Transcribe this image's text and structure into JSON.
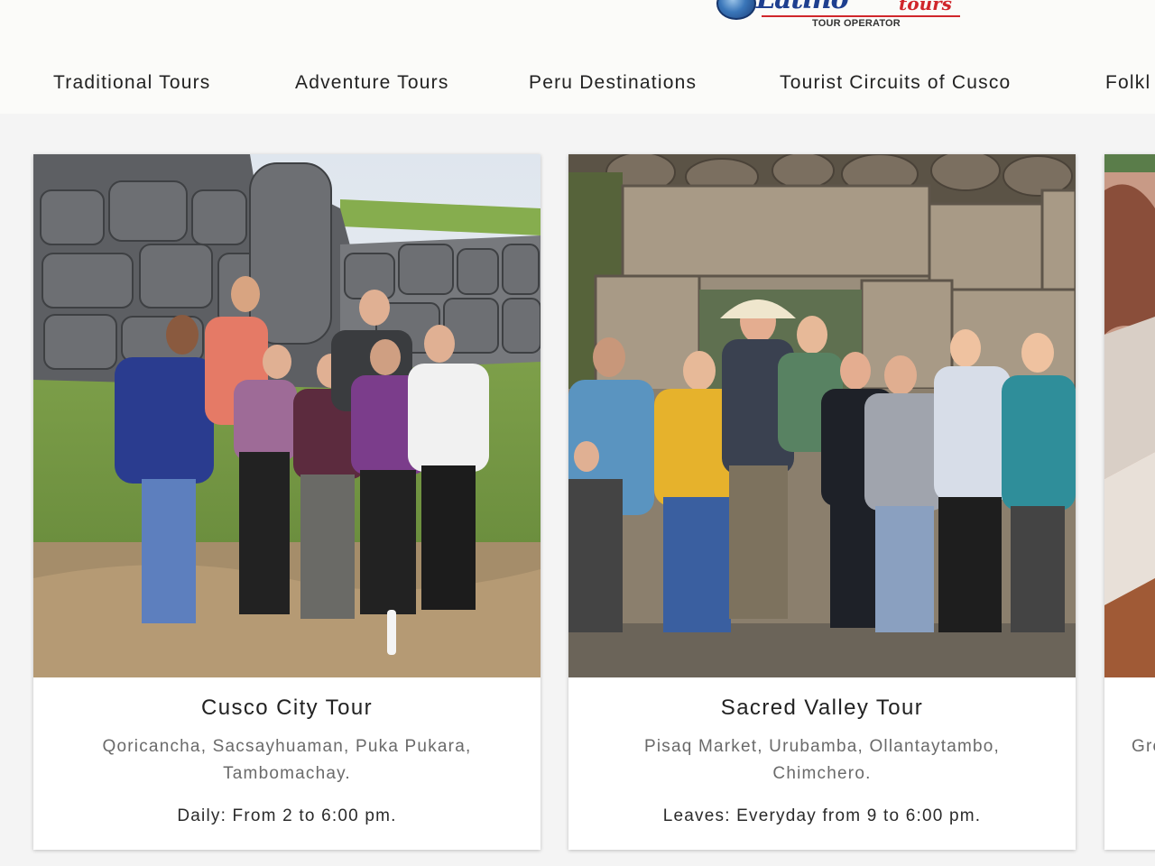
{
  "header": {
    "logo": {
      "word": "Latino",
      "tours": "tours",
      "subtitle": "TOUR OPERATOR"
    },
    "nav": [
      {
        "label": "Traditional Tours"
      },
      {
        "label": "Adventure Tours"
      },
      {
        "label": "Peru Destinations"
      },
      {
        "label": "Tourist Circuits of Cusco"
      },
      {
        "label": "Folkl"
      }
    ]
  },
  "cards": [
    {
      "title": "Cusco City Tour",
      "description": "Qoricancha, Sacsayhuaman, Puka Pukara, Tambomachay.",
      "schedule": "Daily: From 2 to 6:00 pm.",
      "photo_icon": "group-at-inca-stone-walls-photo"
    },
    {
      "title": "Sacred Valley Tour",
      "description": "Pisaq Market, Urubamba, Ollantaytambo, Chimchero.",
      "schedule": "Leaves: Everyday from 9 to 6:00 pm.",
      "photo_icon": "group-at-stone-doorway-photo"
    },
    {
      "title": "",
      "description": "Gre",
      "schedule": "",
      "photo_icon": "salt-terraces-photo"
    }
  ]
}
